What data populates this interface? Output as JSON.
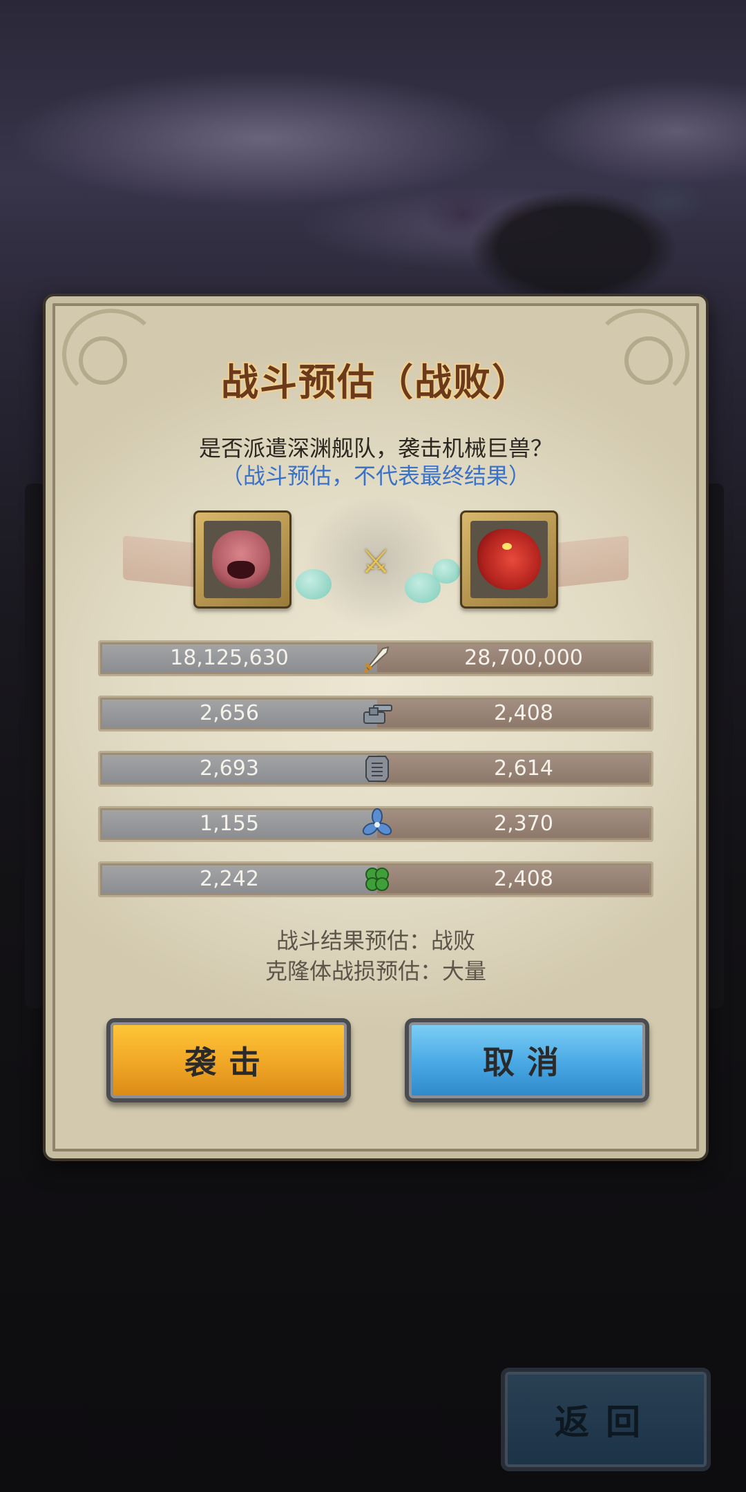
{
  "dialog": {
    "title": "战斗预估（战败）",
    "question": "是否派遣深渊舰队，袭击机械巨兽？",
    "note": "（战斗预估，不代表最终结果）"
  },
  "stats": [
    {
      "icon": "sword-icon",
      "left": "18,125,630",
      "right": "28,700,000"
    },
    {
      "icon": "cannon-icon",
      "left": "2,656",
      "right": "2,408"
    },
    {
      "icon": "armor-icon",
      "left": "2,693",
      "right": "2,614"
    },
    {
      "icon": "propeller-icon",
      "left": "1,155",
      "right": "2,370"
    },
    {
      "icon": "clover-icon",
      "left": "2,242",
      "right": "2,408"
    }
  ],
  "result": {
    "outcome": "战斗结果预估：战败",
    "losses": "克隆体战损预估：大量"
  },
  "buttons": {
    "attack": "袭击",
    "cancel": "取消",
    "back": "返回"
  },
  "colors": {
    "attack_button": "#f0a626",
    "cancel_button": "#48a8e4",
    "title": "#6a3a1a",
    "note": "#3a72c8"
  }
}
